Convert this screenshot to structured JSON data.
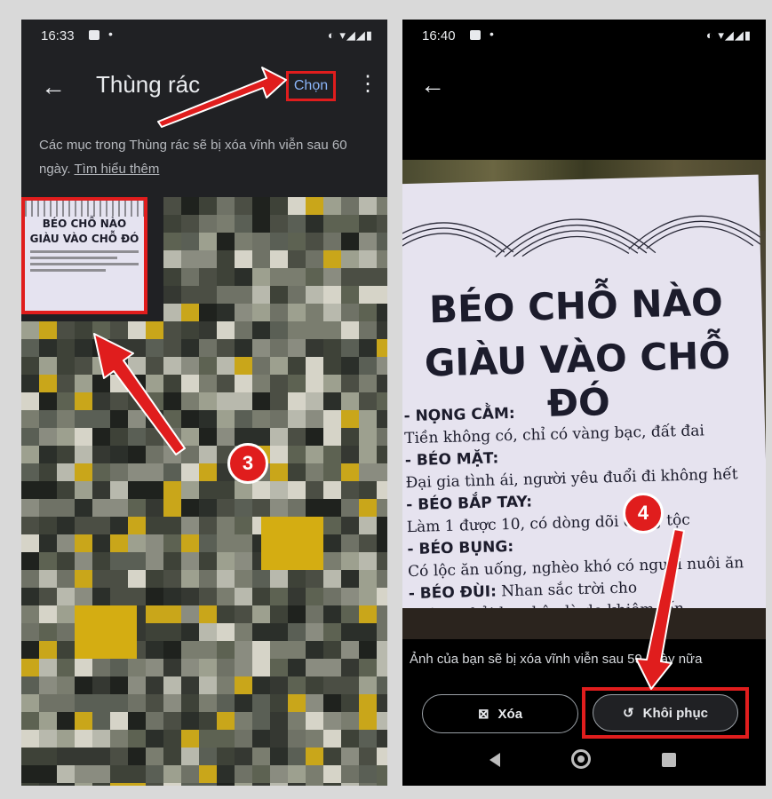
{
  "left_screen": {
    "status": {
      "time": "16:33",
      "dot": "•"
    },
    "header": {
      "back_icon": "arrow-left-icon",
      "title": "Thùng rác",
      "select_label": "Chọn",
      "more_icon": "more-vert-icon"
    },
    "info_text": "Các mục trong Thùng rác sẽ bị xóa vĩnh viễn sau 60 ngày.",
    "learn_more": "Tìm hiểu thêm",
    "thumbnail": {
      "heading_line1": "BÉO CHỖ NÀO",
      "heading_line2": "GIÀU VÀO CHỖ ĐÓ"
    },
    "step_badge": "3"
  },
  "right_screen": {
    "status": {
      "time": "16:40",
      "dot": "•"
    },
    "photo": {
      "heading_line1": "BÉO CHỖ NÀO",
      "heading_line2": "GIÀU VÀO CHỖ ĐÓ",
      "lines": [
        {
          "label": "- NỌNG CẰM:",
          "text": "Tiền không có, chỉ có vàng bạc, đất đai"
        },
        {
          "label": "- BÉO MẶT:",
          "text": "Đại gia tình ái, người yêu đuổi đi không hết"
        },
        {
          "label": "- BÉO BẮP TAY:",
          "text": "Làm 1 được 10, có dòng dõi dòng tộc"
        },
        {
          "label": "- BÉO BỤNG:",
          "text": "Có lộc ăn uống, nghèo khó có người nuôi ăn"
        },
        {
          "label": "- BÉO ĐÙI:",
          "inline": "Nhan sắc trời cho",
          "text": "không phải hoa hậu là do khiêm tốn"
        }
      ]
    },
    "caption": "Ảnh của bạn sẽ bị xóa vĩnh viễn sau 59 ngày nữa",
    "delete_label": "Xóa",
    "restore_label": "Khôi phục",
    "step_badge": "4"
  },
  "colors": {
    "highlight": "#e01d1d",
    "accent_blue": "#8ab4f8",
    "dark_bg": "#202124"
  }
}
